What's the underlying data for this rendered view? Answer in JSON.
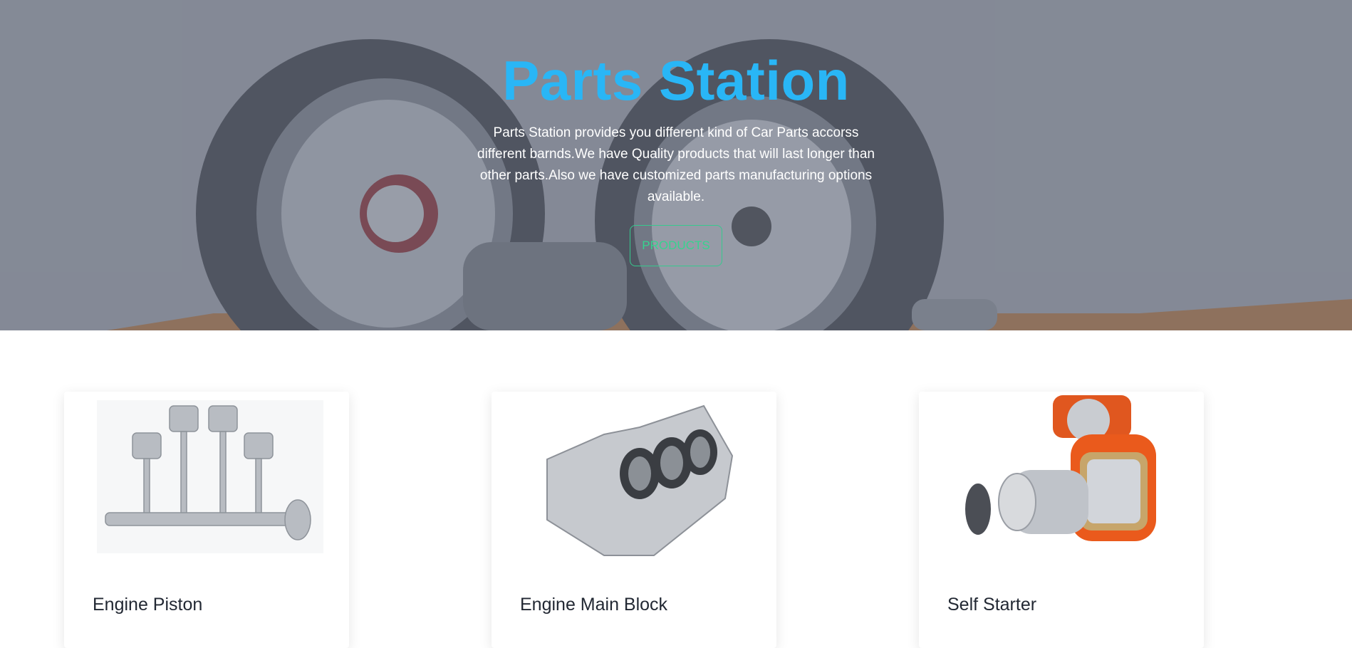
{
  "hero": {
    "title": "Parts Station",
    "description": "Parts Station provides you different kind of Car Parts accorss different barnds.We have Quality products that will last longer than other parts.Also we have customized parts manufacturing options available.",
    "button_label": "PRODUCTS",
    "title_color": "#29b6f6",
    "button_color": "#36c98e"
  },
  "products": [
    {
      "name": "Engine Piston",
      "image": "engine-piston-image",
      "desc": ""
    },
    {
      "name": "Engine Main Block",
      "image": "engine-block-image",
      "desc": ""
    },
    {
      "name": "Self Starter",
      "image": "self-starter-image",
      "desc": ""
    }
  ]
}
